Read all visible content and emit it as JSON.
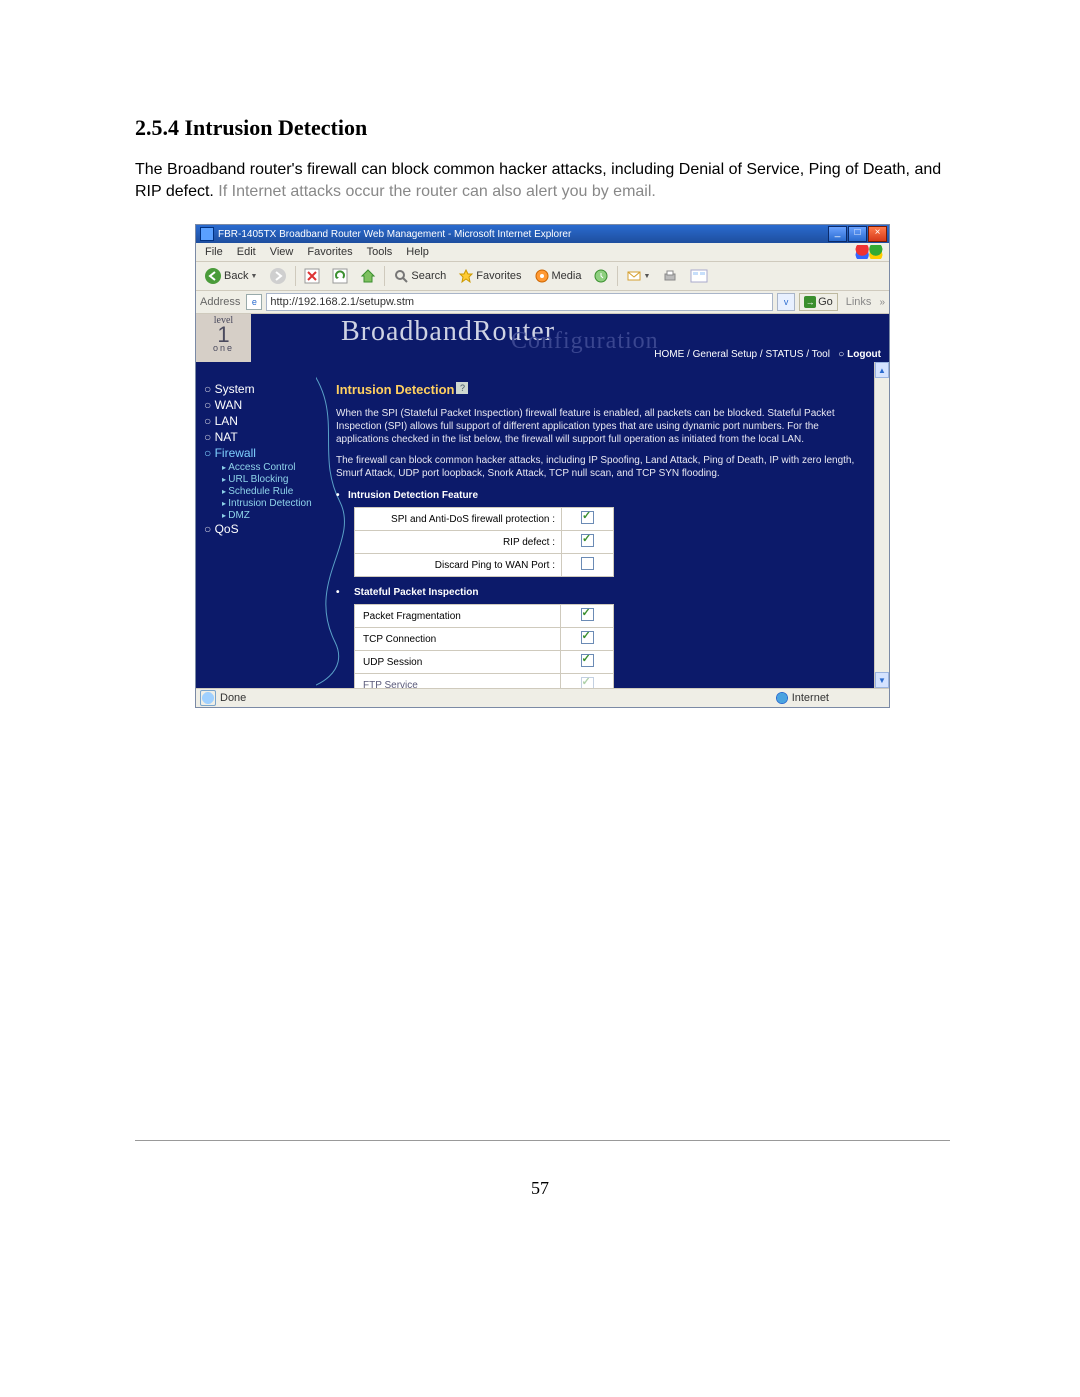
{
  "doc": {
    "heading": "2.5.4 Intrusion Detection",
    "intro_a": "The Broadband router's firewall can block common hacker attacks, including Denial of Service, Ping of Death, and RIP defect.",
    "intro_b": " If Internet attacks occur the router can also alert you by email.",
    "page_number": "57"
  },
  "window": {
    "title": "FBR-1405TX Broadband Router Web Management - Microsoft Internet Explorer",
    "min": "_",
    "max": "□",
    "close": "×"
  },
  "menubar": {
    "items": [
      "File",
      "Edit",
      "View",
      "Favorites",
      "Tools",
      "Help"
    ]
  },
  "toolbar": {
    "back": "Back",
    "search": "Search",
    "favorites": "Favorites",
    "media": "Media"
  },
  "address_bar": {
    "label": "Address",
    "url": "http://192.168.2.1/setupw.stm",
    "go": "Go",
    "links": "Links"
  },
  "banner": {
    "logo_a": "level",
    "logo_b": "1",
    "logo_c": "one",
    "title_a": "BroadbandRouter",
    "title_b": "Configuration",
    "links": {
      "home": "HOME",
      "general": "General Setup",
      "status": "STATUS",
      "tool": "Tool",
      "logout": "Logout"
    }
  },
  "sidebar": {
    "system": "System",
    "wan": "WAN",
    "lan": "LAN",
    "nat": "NAT",
    "firewall": "Firewall",
    "sub": {
      "access": "Access Control",
      "url": "URL Blocking",
      "schedule": "Schedule Rule",
      "intrusion": "Intrusion Detection",
      "dmz": "DMZ"
    },
    "qos": "QoS"
  },
  "content": {
    "title": "Intrusion Detection",
    "help": "?",
    "para1": "When the SPI (Stateful Packet Inspection) firewall feature is enabled, all packets can be blocked.  Stateful Packet Inspection (SPI) allows full support of different application types that are using dynamic port numbers.  For the applications checked in the list below, the firewall will support full operation as initiated from the local LAN.",
    "para2": "The firewall can block common hacker attacks, including IP Spoofing, Land Attack, Ping of Death, IP with zero length, Smurf Attack, UDP port loopback, Snork Attack, TCP null scan, and TCP SYN flooding.",
    "section1": "Intrusion Detection Feature",
    "rows1": [
      {
        "label": "SPI and Anti-DoS firewall protection :",
        "checked": true
      },
      {
        "label": "RIP defect :",
        "checked": true
      },
      {
        "label": "Discard Ping to WAN Port :",
        "checked": false
      }
    ],
    "section2": "Stateful Packet Inspection",
    "rows2": [
      {
        "label": "Packet Fragmentation",
        "checked": true
      },
      {
        "label": "TCP Connection",
        "checked": true
      },
      {
        "label": "UDP Session",
        "checked": true
      },
      {
        "label": "FTP Service",
        "checked": true
      }
    ]
  },
  "statusbar": {
    "done": "Done",
    "zone": "Internet"
  }
}
